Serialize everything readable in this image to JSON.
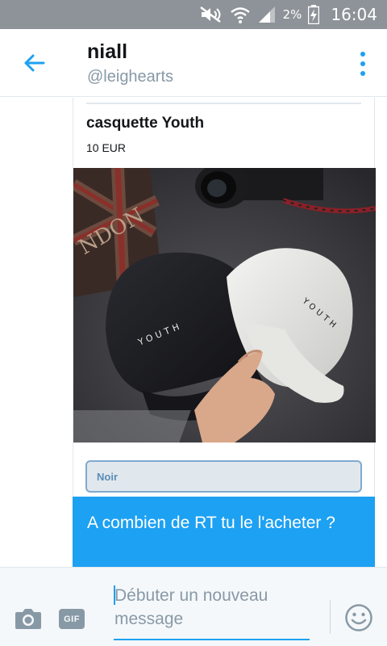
{
  "status_bar": {
    "battery_percent": "2%",
    "time": "16:04",
    "icons": [
      "mute-icon",
      "wifi-icon",
      "signal-icon",
      "battery-charging-icon"
    ]
  },
  "header": {
    "name": "niall",
    "handle": "@leighearts",
    "back_icon": "back-arrow-icon",
    "menu_icon": "more-vertical-icon"
  },
  "card": {
    "title": "casquette Youth",
    "price": "10 EUR",
    "image": {
      "cap_text_left": "YOUTH",
      "cap_text_right": "YOUTH",
      "poster_text": "NDON"
    }
  },
  "option": {
    "label": "Noir"
  },
  "message": {
    "text": "A combien de RT tu le l'acheter ?"
  },
  "composer": {
    "placeholder": "Débuter un nouveau message",
    "gif_label": "GIF",
    "camera_icon": "camera-icon",
    "emoji_icon": "emoji-icon"
  },
  "colors": {
    "accent": "#1da1f2",
    "status_bar": "#8d9398",
    "muted": "#8899a6"
  }
}
